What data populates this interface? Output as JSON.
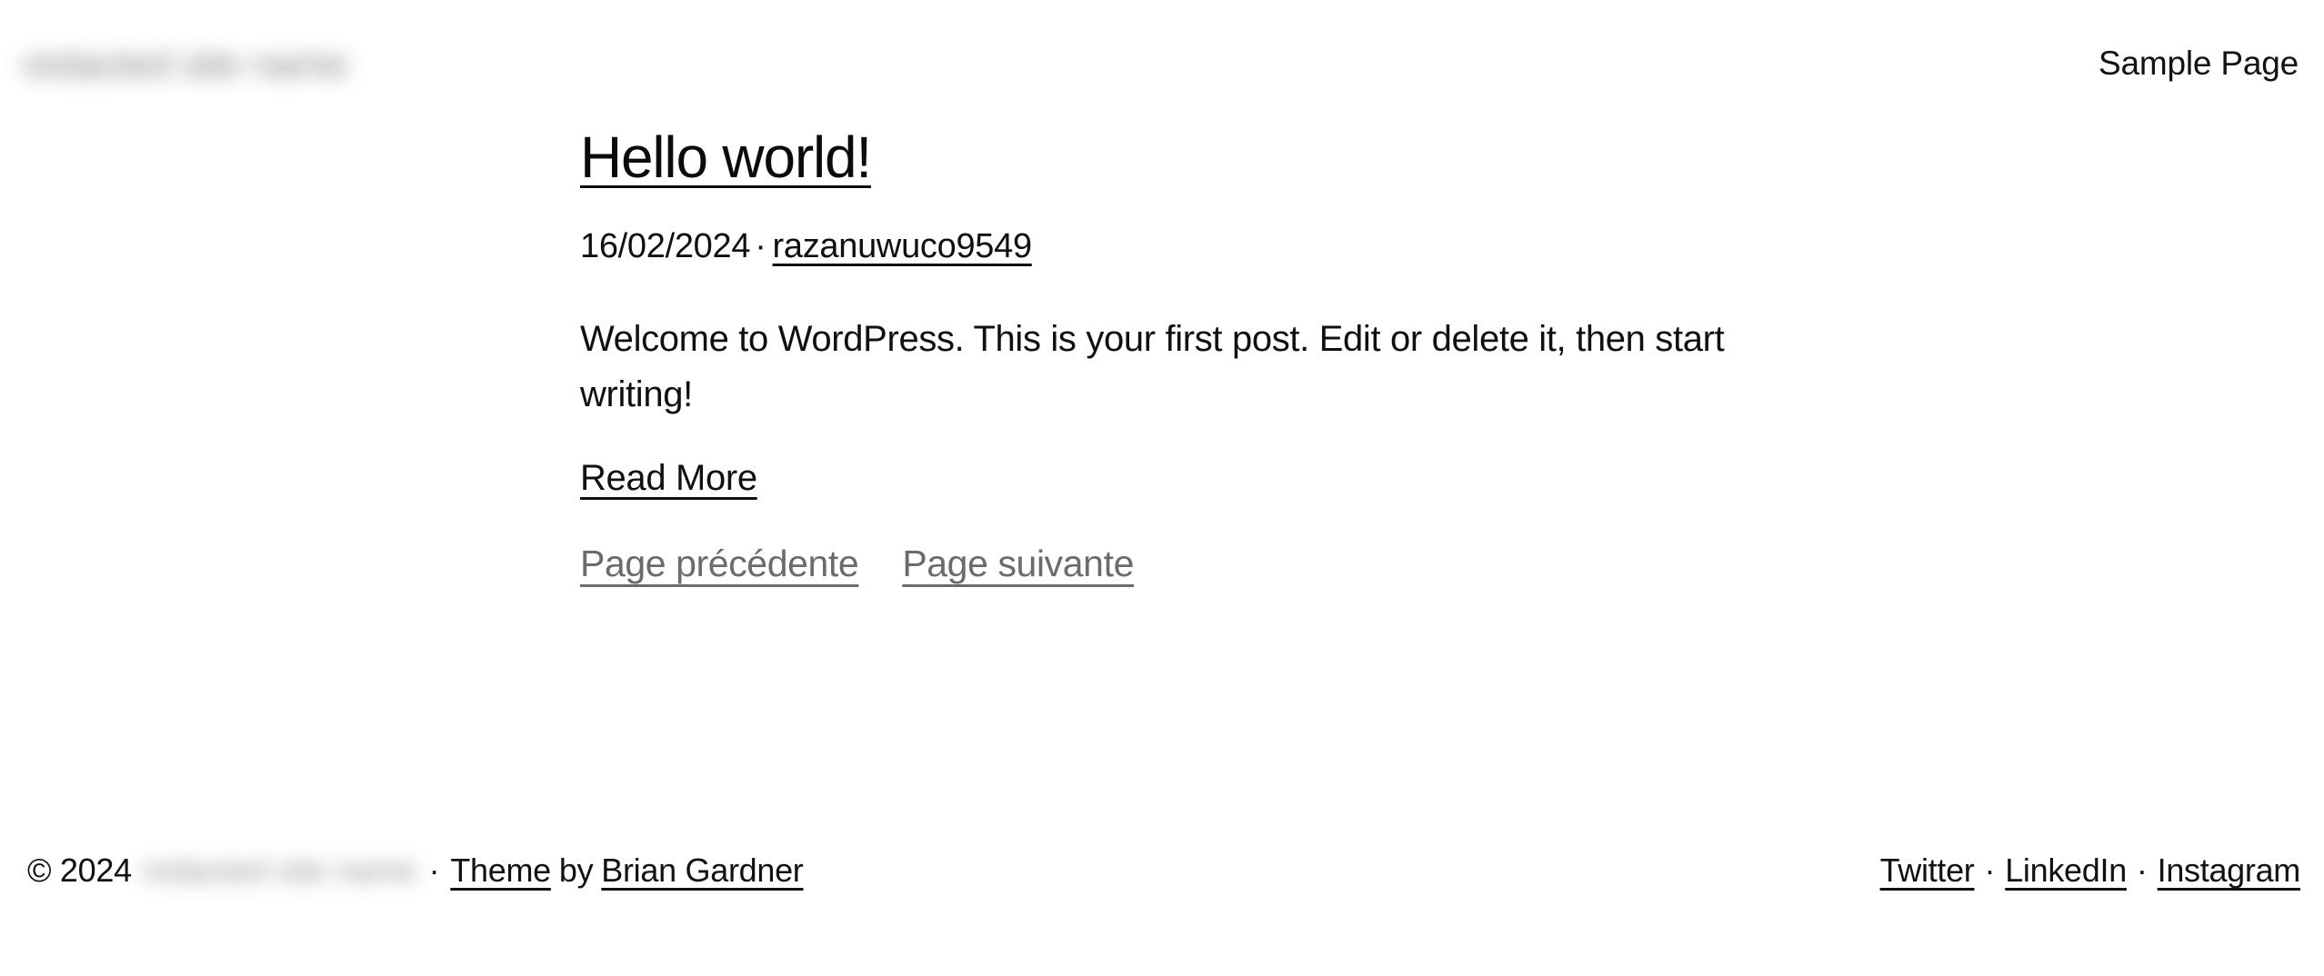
{
  "header": {
    "site_title": "redacted site name",
    "site_title_redacted": true,
    "nav": [
      {
        "label": "Sample Page"
      }
    ]
  },
  "main": {
    "post": {
      "title": "Hello world!",
      "date": "16/02/2024",
      "meta_separator": "·",
      "author": "razanuwuco9549",
      "excerpt": "Welcome to WordPress. This is your first post. Edit or delete it, then start writing!",
      "read_more_label": "Read More"
    },
    "pagination": {
      "previous_label": "Page précédente",
      "next_label": "Page suivante"
    }
  },
  "footer": {
    "copyright": "© 2024",
    "site_name": "redacted site name",
    "site_name_redacted": true,
    "separator": "·",
    "theme_label": "Theme",
    "by_label": "by",
    "theme_author": "Brian Gardner",
    "social": [
      {
        "label": "Twitter"
      },
      {
        "label": "LinkedIn"
      },
      {
        "label": "Instagram"
      }
    ],
    "social_separator": "·"
  },
  "colors": {
    "background": "#ffffff",
    "text": "#111111",
    "muted_text": "#6b6b6b",
    "link": "#101010"
  }
}
